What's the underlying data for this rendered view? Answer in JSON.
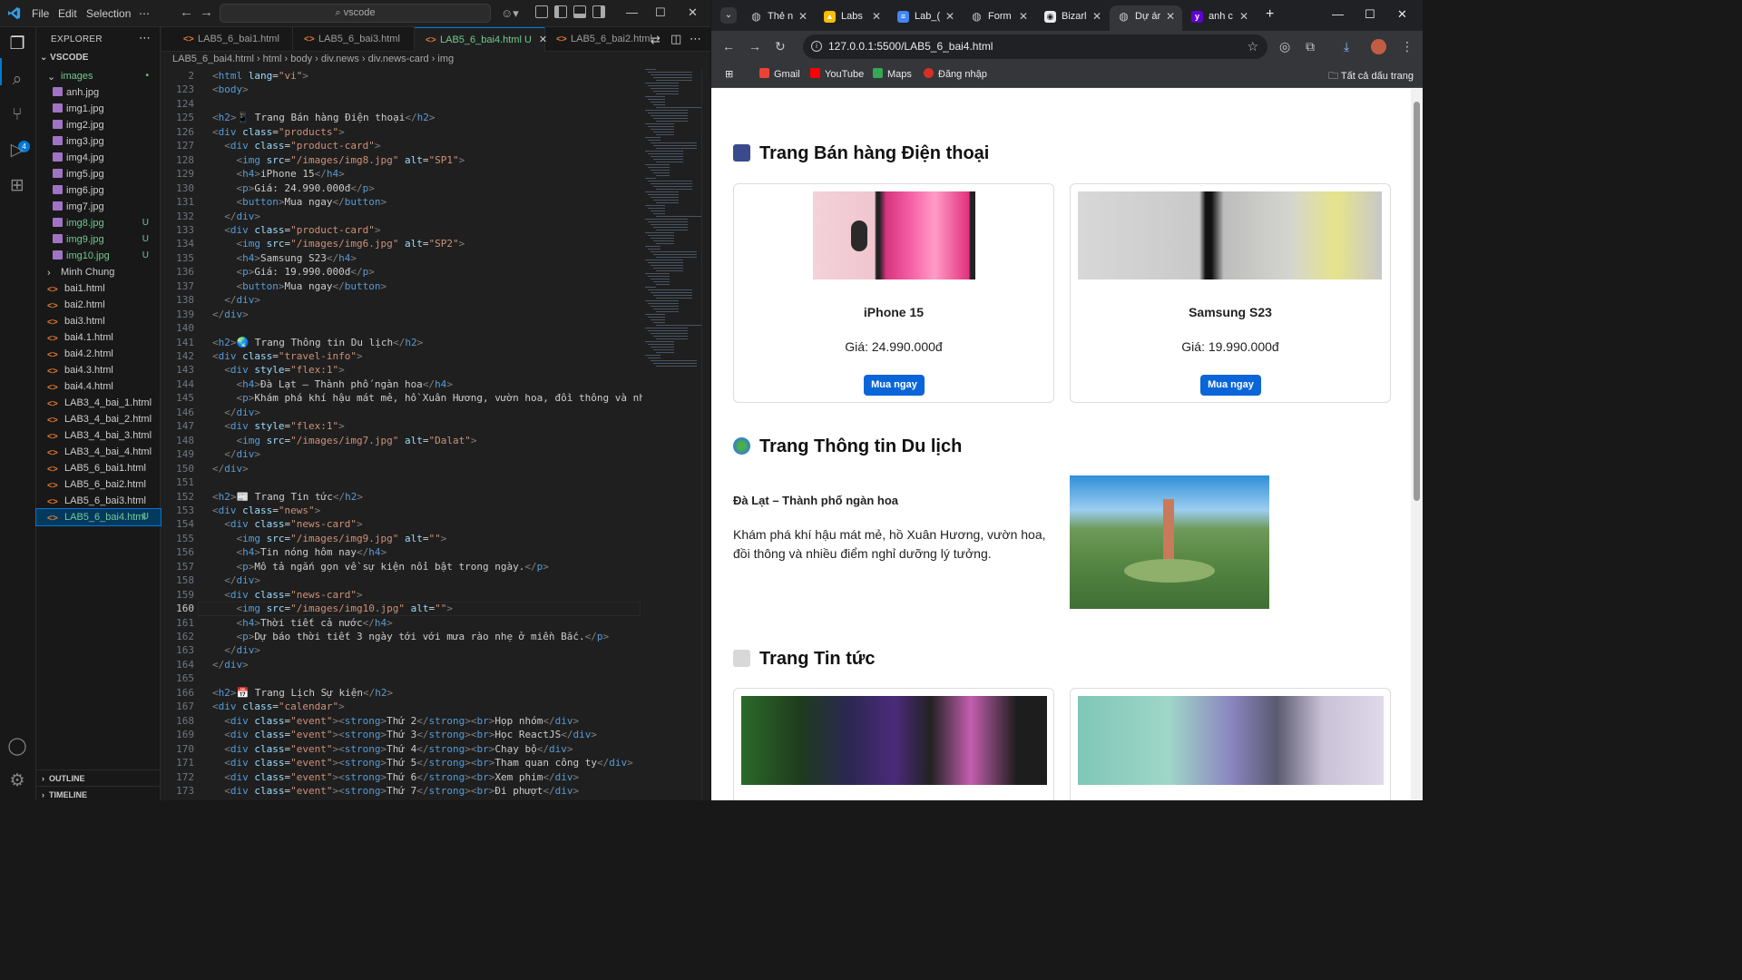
{
  "vscode": {
    "menu": [
      "File",
      "Edit",
      "Selection",
      "⋯"
    ],
    "search_label": "vscode",
    "explorer": {
      "title": "EXPLORER",
      "root": "VSCODE",
      "items": [
        {
          "name": "images",
          "status": "•",
          "kind": "folder"
        },
        {
          "name": "anh.jpg",
          "status": "",
          "kind": "img"
        },
        {
          "name": "img1.jpg",
          "status": "",
          "kind": "img"
        },
        {
          "name": "img2.jpg",
          "status": "",
          "kind": "img"
        },
        {
          "name": "img3.jpg",
          "status": "",
          "kind": "img"
        },
        {
          "name": "img4.jpg",
          "status": "",
          "kind": "img"
        },
        {
          "name": "img5.jpg",
          "status": "",
          "kind": "img"
        },
        {
          "name": "img6.jpg",
          "status": "",
          "kind": "img"
        },
        {
          "name": "img7.jpg",
          "status": "",
          "kind": "img"
        },
        {
          "name": "img8.jpg",
          "status": "U",
          "kind": "img"
        },
        {
          "name": "img9.jpg",
          "status": "U",
          "kind": "img"
        },
        {
          "name": "img10.jpg",
          "status": "U",
          "kind": "img"
        },
        {
          "name": "Minh Chung",
          "status": "",
          "kind": "folder-closed"
        },
        {
          "name": "bai1.html",
          "status": "",
          "kind": "html"
        },
        {
          "name": "bai2.html",
          "status": "",
          "kind": "html"
        },
        {
          "name": "bai3.html",
          "status": "",
          "kind": "html"
        },
        {
          "name": "bai4.1.html",
          "status": "",
          "kind": "html"
        },
        {
          "name": "bai4.2.html",
          "status": "",
          "kind": "html"
        },
        {
          "name": "bai4.3.html",
          "status": "",
          "kind": "html"
        },
        {
          "name": "bai4.4.html",
          "status": "",
          "kind": "html"
        },
        {
          "name": "LAB3_4_bai_1.html",
          "status": "",
          "kind": "html"
        },
        {
          "name": "LAB3_4_bai_2.html",
          "status": "",
          "kind": "html"
        },
        {
          "name": "LAB3_4_bai_3.html",
          "status": "",
          "kind": "html"
        },
        {
          "name": "LAB3_4_bai_4.html",
          "status": "",
          "kind": "html"
        },
        {
          "name": "LAB5_6_bai1.html",
          "status": "",
          "kind": "html"
        },
        {
          "name": "LAB5_6_bai2.html",
          "status": "",
          "kind": "html"
        },
        {
          "name": "LAB5_6_bai3.html",
          "status": "",
          "kind": "html"
        },
        {
          "name": "LAB5_6_bai4.html",
          "status": "U",
          "kind": "html-selected"
        }
      ],
      "outline": "OUTLINE",
      "timeline": "TIMELINE"
    },
    "tabs": [
      {
        "label": "LAB5_6_bai1.html",
        "active": false
      },
      {
        "label": "LAB5_6_bai3.html",
        "active": false
      },
      {
        "label": "LAB5_6_bai4.html U",
        "active": true
      },
      {
        "label": "LAB5_6_bai2.html",
        "active": false
      }
    ],
    "breadcrumb": "LAB5_6_bai4.html  ›  html  ›  body  ›  div.news  ›  div.news-card  ›  img",
    "current_line": 160,
    "lines": [
      {
        "n": 2,
        "code": "<html lang=\"vi\">"
      },
      {
        "n": 123,
        "code": "<body>"
      },
      {
        "n": 124,
        "code": ""
      },
      {
        "n": 125,
        "code": "<h2>📱 Trang Bán hàng Điện thoại</h2>"
      },
      {
        "n": 126,
        "code": "<div class=\"products\">"
      },
      {
        "n": 127,
        "code": "  <div class=\"product-card\">"
      },
      {
        "n": 128,
        "code": "    <img src=\"/images/img8.jpg\" alt=\"SP1\">"
      },
      {
        "n": 129,
        "code": "    <h4>iPhone 15</h4>"
      },
      {
        "n": 130,
        "code": "    <p>Giá: 24.990.000đ</p>"
      },
      {
        "n": 131,
        "code": "    <button>Mua ngay</button>"
      },
      {
        "n": 132,
        "code": "  </div>"
      },
      {
        "n": 133,
        "code": "  <div class=\"product-card\">"
      },
      {
        "n": 134,
        "code": "    <img src=\"/images/img6.jpg\" alt=\"SP2\">"
      },
      {
        "n": 135,
        "code": "    <h4>Samsung S23</h4>"
      },
      {
        "n": 136,
        "code": "    <p>Giá: 19.990.000đ</p>"
      },
      {
        "n": 137,
        "code": "    <button>Mua ngay</button>"
      },
      {
        "n": 138,
        "code": "  </div>"
      },
      {
        "n": 139,
        "code": "</div>"
      },
      {
        "n": 140,
        "code": ""
      },
      {
        "n": 141,
        "code": "<h2>🌏 Trang Thông tin Du lịch</h2>"
      },
      {
        "n": 142,
        "code": "<div class=\"travel-info\">"
      },
      {
        "n": 143,
        "code": "  <div style=\"flex:1\">"
      },
      {
        "n": 144,
        "code": "    <h4>Đà Lạt – Thành phố ngàn hoa</h4>"
      },
      {
        "n": 145,
        "code": "    <p>Khám phá khí hậu mát mẻ, hồ Xuân Hương, vườn hoa, đồi thông và nhiều"
      },
      {
        "n": 146,
        "code": "  </div>"
      },
      {
        "n": 147,
        "code": "  <div style=\"flex:1\">"
      },
      {
        "n": 148,
        "code": "    <img src=\"/images/img7.jpg\" alt=\"Dalat\">"
      },
      {
        "n": 149,
        "code": "  </div>"
      },
      {
        "n": 150,
        "code": "</div>"
      },
      {
        "n": 151,
        "code": ""
      },
      {
        "n": 152,
        "code": "<h2>📰 Trang Tin tức</h2>"
      },
      {
        "n": 153,
        "code": "<div class=\"news\">"
      },
      {
        "n": 154,
        "code": "  <div class=\"news-card\">"
      },
      {
        "n": 155,
        "code": "    <img src=\"/images/img9.jpg\" alt=\"\">"
      },
      {
        "n": 156,
        "code": "    <h4>Tin nóng hôm nay</h4>"
      },
      {
        "n": 157,
        "code": "    <p>Mô tả ngắn gọn về sự kiện nổi bật trong ngày.</p>"
      },
      {
        "n": 158,
        "code": "  </div>"
      },
      {
        "n": 159,
        "code": "  <div class=\"news-card\">"
      },
      {
        "n": 160,
        "code": "    <img src=\"/images/img10.jpg\" alt=\"\">"
      },
      {
        "n": 161,
        "code": "    <h4>Thời tiết cả nước</h4>"
      },
      {
        "n": 162,
        "code": "    <p>Dự báo thời tiết 3 ngày tới với mưa rào nhẹ ở miền Bắc.</p>"
      },
      {
        "n": 163,
        "code": "  </div>"
      },
      {
        "n": 164,
        "code": "</div>"
      },
      {
        "n": 165,
        "code": ""
      },
      {
        "n": 166,
        "code": "<h2>📅 Trang Lịch Sự kiện</h2>"
      },
      {
        "n": 167,
        "code": "<div class=\"calendar\">"
      },
      {
        "n": 168,
        "code": "  <div class=\"event\"><strong>Thứ 2</strong><br>Họp nhóm</div>"
      },
      {
        "n": 169,
        "code": "  <div class=\"event\"><strong>Thứ 3</strong><br>Học ReactJS</div>"
      },
      {
        "n": 170,
        "code": "  <div class=\"event\"><strong>Thứ 4</strong><br>Chạy bộ</div>"
      },
      {
        "n": 171,
        "code": "  <div class=\"event\"><strong>Thứ 5</strong><br>Tham quan công ty</div>"
      },
      {
        "n": 172,
        "code": "  <div class=\"event\"><strong>Thứ 6</strong><br>Xem phim</div>"
      },
      {
        "n": 173,
        "code": "  <div class=\"event\"><strong>Thứ 7</strong><br>Đi phượt</div>"
      }
    ]
  },
  "chrome": {
    "tabs": [
      {
        "label": "Thẻ n",
        "icon": "globe-icon"
      },
      {
        "label": "Labs",
        "icon": "drive-icon"
      },
      {
        "label": "Lab_(",
        "icon": "docs-icon"
      },
      {
        "label": "Form",
        "icon": "globe-icon"
      },
      {
        "label": "Bizarl",
        "icon": "github-icon"
      },
      {
        "label": "Dự ár",
        "icon": "globe-icon",
        "active": true
      },
      {
        "label": "anh c",
        "icon": "yahoo-icon"
      }
    ],
    "url": "127.0.0.1:5500/LAB5_6_bai4.html",
    "bookmarks": [
      "Gmail",
      "YouTube",
      "Maps",
      "Đăng nhập"
    ],
    "all_bookmarks": "Tất cả dấu trang"
  },
  "page": {
    "shop_title": "Trang Bán hàng Điện thoại",
    "products": [
      {
        "name": "iPhone 15",
        "price": "Giá: 24.990.000đ",
        "button": "Mua ngay"
      },
      {
        "name": "Samsung S23",
        "price": "Giá: 19.990.000đ",
        "button": "Mua ngay"
      }
    ],
    "travel_title": "Trang Thông tin Du lịch",
    "travel_heading": "Đà Lạt – Thành phố ngàn hoa",
    "travel_text": "Khám phá khí hậu mát mẻ, hồ Xuân Hương, vườn hoa, đồi thông và nhiều điểm nghỉ dưỡng lý tưởng.",
    "news_title": "Trang Tin tức"
  },
  "colors": {
    "accent": "#0078d4",
    "button": "#0a66d8",
    "untracked": "#73c991"
  }
}
